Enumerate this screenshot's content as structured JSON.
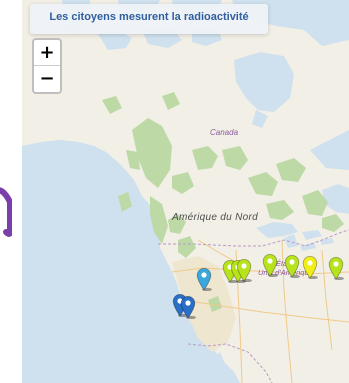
{
  "map": {
    "title": "Les citoyens mesurent la radioactivité",
    "labels": {
      "canada": "Canada",
      "continent": "Amérique du Nord",
      "usa_line1": "États-",
      "usa_line2": "Unis d'Amérique"
    },
    "zoom": {
      "in_label": "+",
      "out_label": "−"
    },
    "colors": {
      "water": "#cfe1ee",
      "land": "#f2efe6",
      "forest": "#bcd9a6",
      "desert": "#eee6cf",
      "marker_green": "#b7e31c",
      "marker_yellow": "#f0ee14",
      "marker_cyan": "#3aa8dc",
      "marker_blue": "#2a6fc6",
      "title_text": "#2f5f9e",
      "edge_glyph": "#7a3fa8"
    },
    "markers": [
      {
        "name": "marker-cyan-1",
        "color": "cyan",
        "icon": "map-pin-icon"
      },
      {
        "name": "marker-green-1",
        "color": "green",
        "icon": "map-pin-icon"
      },
      {
        "name": "marker-green-2",
        "color": "green",
        "icon": "map-pin-icon"
      },
      {
        "name": "marker-green-3",
        "color": "green",
        "icon": "map-pin-icon"
      },
      {
        "name": "marker-green-4",
        "color": "green",
        "icon": "map-pin-icon"
      },
      {
        "name": "marker-green-5",
        "color": "green",
        "icon": "map-pin-icon"
      },
      {
        "name": "marker-yellow-1",
        "color": "yellow",
        "icon": "map-pin-icon"
      },
      {
        "name": "marker-green-6",
        "color": "green",
        "icon": "map-pin-icon"
      },
      {
        "name": "marker-blue-1",
        "color": "blue",
        "icon": "map-pin-icon"
      },
      {
        "name": "marker-blue-2",
        "color": "blue",
        "icon": "map-pin-icon"
      }
    ]
  }
}
